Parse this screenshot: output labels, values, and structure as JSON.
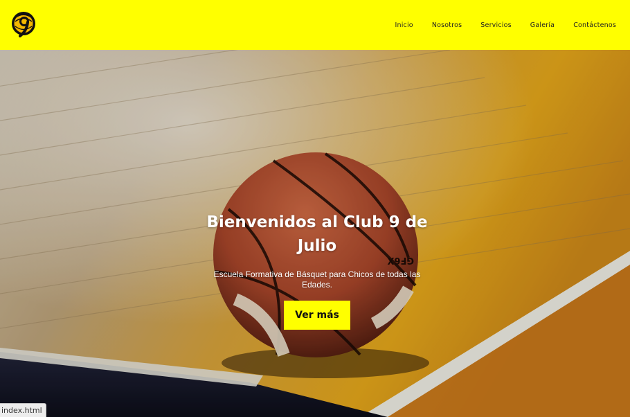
{
  "header": {
    "logo_icon": "club-9-de-julio-basketball-logo",
    "nav": [
      {
        "label": "Inicio"
      },
      {
        "label": "Nosotros"
      },
      {
        "label": "Servicios"
      },
      {
        "label": "Galería"
      },
      {
        "label": "Contáctenos"
      }
    ]
  },
  "hero": {
    "title": "Bienvenidos al Club 9 de Julio",
    "subtitle": "Escuela Formativa de Básquet para Chicos de todas las Edades.",
    "button_label": "Ver más",
    "background_icon": "basketball-on-court-photo",
    "ball_text": "GF6X"
  },
  "status_bar": {
    "url": "index.html"
  },
  "colors": {
    "accent": "#ffff00",
    "text_light": "#ffffff"
  }
}
